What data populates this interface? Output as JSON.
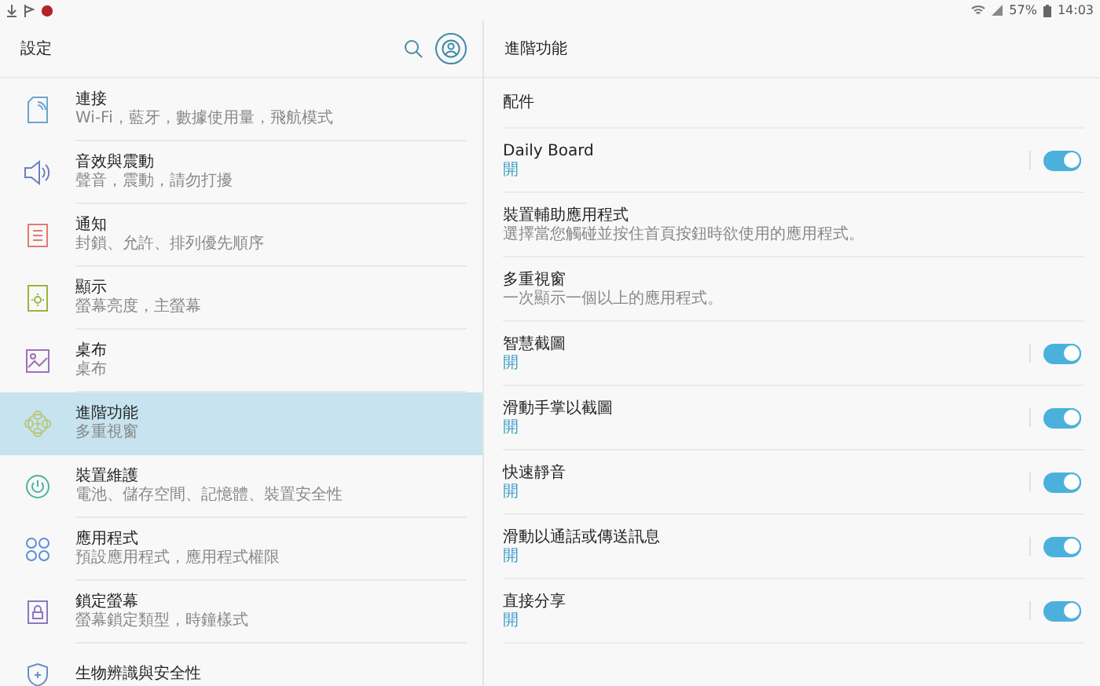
{
  "status_bar": {
    "battery": "57%",
    "time": "14:03"
  },
  "sidebar": {
    "title": "設定",
    "items": [
      {
        "title": "連接",
        "subtitle": "Wi-Fi，藍牙，數據使用量，飛航模式",
        "selected": false
      },
      {
        "title": "音效與震動",
        "subtitle": "聲音，震動，請勿打擾",
        "selected": false
      },
      {
        "title": "通知",
        "subtitle": "封鎖、允許、排列優先順序",
        "selected": false
      },
      {
        "title": "顯示",
        "subtitle": "螢幕亮度，主螢幕",
        "selected": false
      },
      {
        "title": "桌布",
        "subtitle": "桌布",
        "selected": false
      },
      {
        "title": "進階功能",
        "subtitle": "多重視窗",
        "selected": true
      },
      {
        "title": "裝置維護",
        "subtitle": "電池、儲存空間、記憶體、裝置安全性",
        "selected": false
      },
      {
        "title": "應用程式",
        "subtitle": "預設應用程式，應用程式權限",
        "selected": false
      },
      {
        "title": "鎖定螢幕",
        "subtitle": "螢幕鎖定類型，時鐘樣式",
        "selected": false
      },
      {
        "title": "生物辨識與安全性",
        "selected": false
      }
    ]
  },
  "detail": {
    "title": "進階功能",
    "items": [
      {
        "kind": "header",
        "title": "配件"
      },
      {
        "kind": "toggle",
        "title": "Daily Board",
        "subtitle": "開",
        "on": true
      },
      {
        "kind": "link",
        "title": "裝置輔助應用程式",
        "subtitle": "選擇當您觸碰並按住首頁按鈕時欲使用的應用程式。"
      },
      {
        "kind": "link",
        "title": "多重視窗",
        "subtitle": "一次顯示一個以上的應用程式。"
      },
      {
        "kind": "toggle",
        "title": "智慧截圖",
        "subtitle": "開",
        "on": true
      },
      {
        "kind": "toggle",
        "title": "滑動手掌以截圖",
        "subtitle": "開",
        "on": true
      },
      {
        "kind": "toggle",
        "title": "快速靜音",
        "subtitle": "開",
        "on": true
      },
      {
        "kind": "toggle",
        "title": "滑動以通話或傳送訊息",
        "subtitle": "開",
        "on": true
      },
      {
        "kind": "toggle",
        "title": "直接分享",
        "subtitle": "開",
        "on": true
      }
    ]
  }
}
